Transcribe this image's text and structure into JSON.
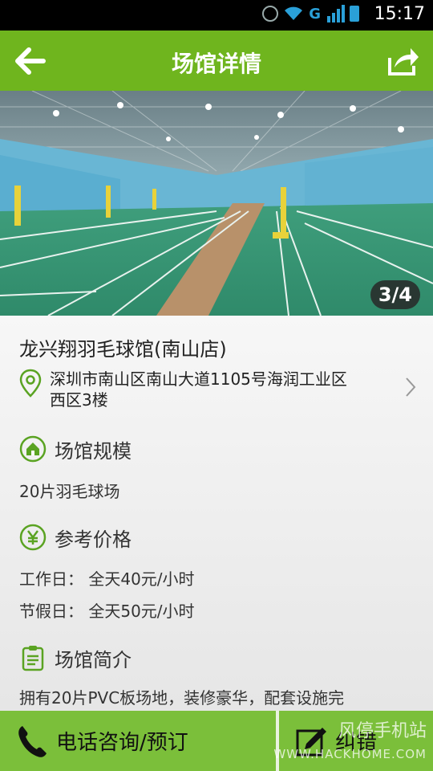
{
  "status_bar": {
    "time": "15:17",
    "network": "G",
    "signal_label": "1"
  },
  "header": {
    "title": "场馆详情",
    "back_icon": "back-arrow-icon",
    "share_icon": "share-icon"
  },
  "gallery": {
    "counter": "3/4",
    "index": 3,
    "total": 4
  },
  "venue": {
    "name": "龙兴翔羽毛球馆(南山店)",
    "address_line1": "深圳市南山区南山大道1105号海润工业区",
    "address_line2": "西区3楼"
  },
  "sections": {
    "scale": {
      "title": "场馆规模",
      "text": "20片羽毛球场"
    },
    "price": {
      "title": "参考价格",
      "weekday": "工作日：  全天40元/小时",
      "holiday": "节假日：  全天50元/小时"
    },
    "intro": {
      "title": "场馆简介",
      "text": "拥有20片PVC板场地，装修豪华，配套设施完"
    }
  },
  "bottom_bar": {
    "call_label": "电话咨询/预订",
    "report_label": "纠错"
  },
  "watermark": {
    "text": "风停手机站",
    "url": "WWW.HACKHOME.COM"
  },
  "colors": {
    "primary": "#6fb51e",
    "bottom": "#7bbf3a",
    "accent": "#5aa322"
  }
}
